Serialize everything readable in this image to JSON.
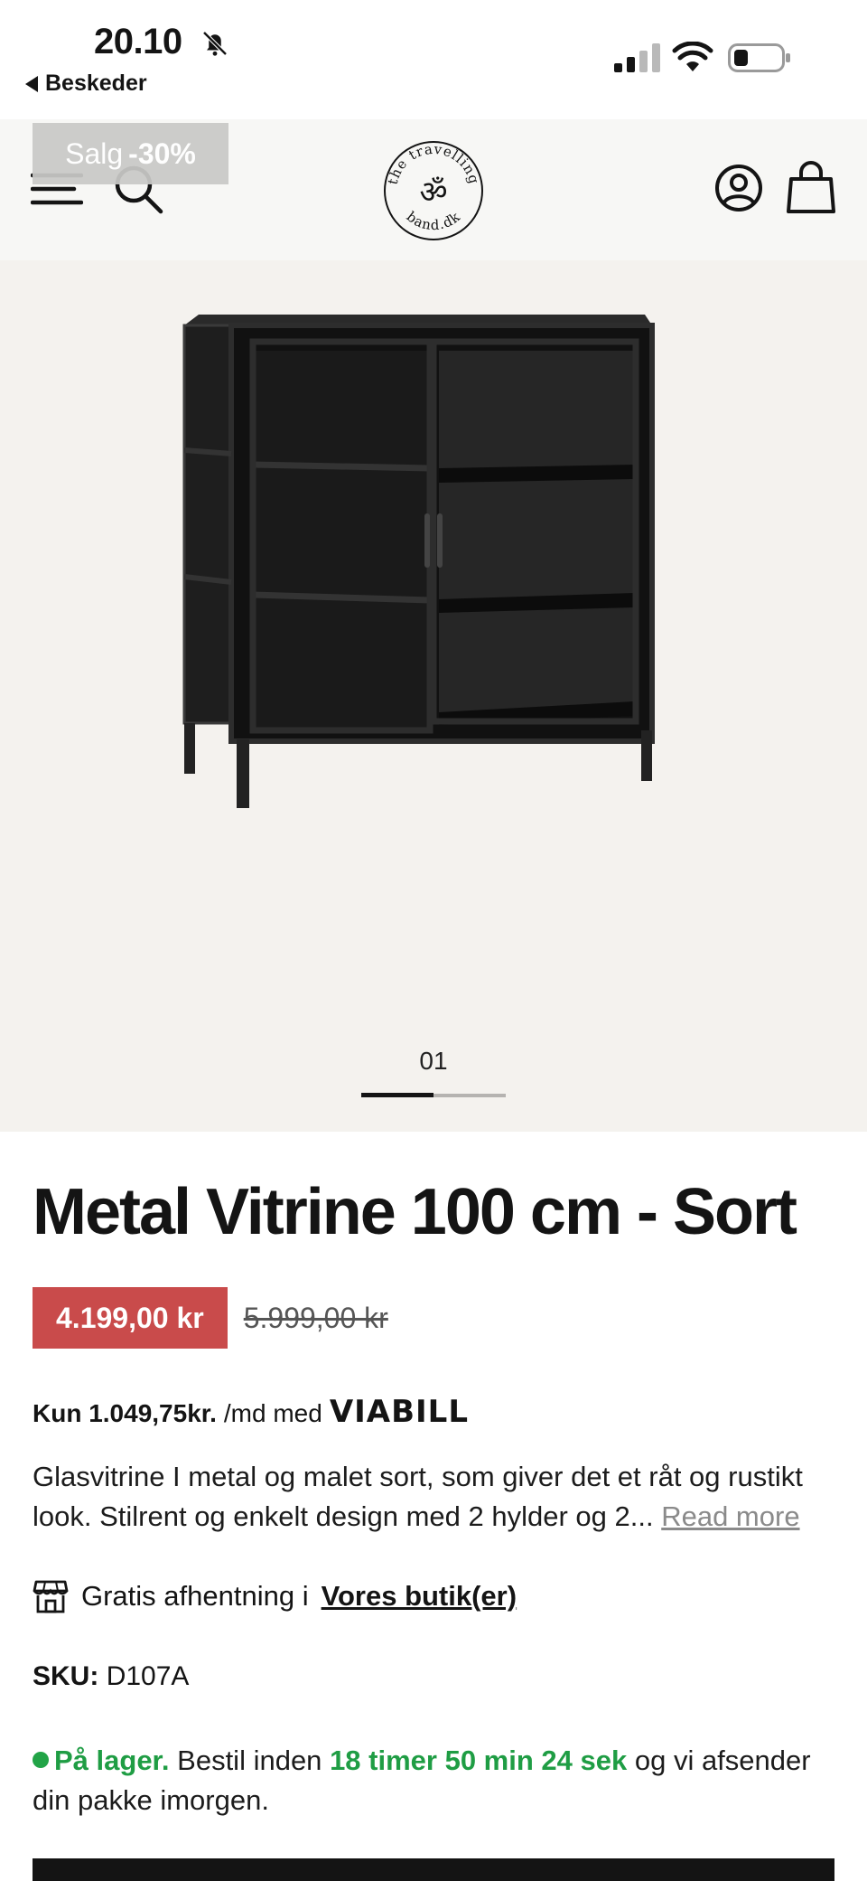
{
  "statusbar": {
    "time": "20.10",
    "back_label": "Beskeder"
  },
  "header": {
    "sale_label": "Salg",
    "sale_discount": "-30%",
    "logo_text_top": "the travelling",
    "logo_text_bottom": "band.dk",
    "logo_symbol": "ॐ"
  },
  "gallery": {
    "slide_index": "01",
    "slide_progress": 0.5
  },
  "product": {
    "title": "Metal Vitrine 100 cm - Sort",
    "price_now": "4.199,00 kr",
    "price_old": "5.999,00 kr",
    "viabill_amount": "Kun 1.049,75kr.",
    "viabill_text": "/md med",
    "viabill_brand": "VIABILL",
    "description": "Glasvitrine I metal og malet sort, som giver det et råt og rustikt look. Stilrent og enkelt design med 2 hylder og 2...",
    "read_more": "Read more",
    "pickup_text": "Gratis afhentning i",
    "pickup_link": "Vores butik(er)",
    "sku_label": "SKU:",
    "sku_value": "D107A",
    "stock_status": "På lager.",
    "stock_text_1": "Bestil inden",
    "stock_timer": "18 timer 50 min 24 sek",
    "stock_text_2": "og vi afsender din pakke imorgen."
  },
  "colors": {
    "price_badge": "#c94b4b",
    "in_stock": "#1f9d44",
    "gallery_bg": "#f4f2ee",
    "header_bg": "#f7f7f5"
  }
}
